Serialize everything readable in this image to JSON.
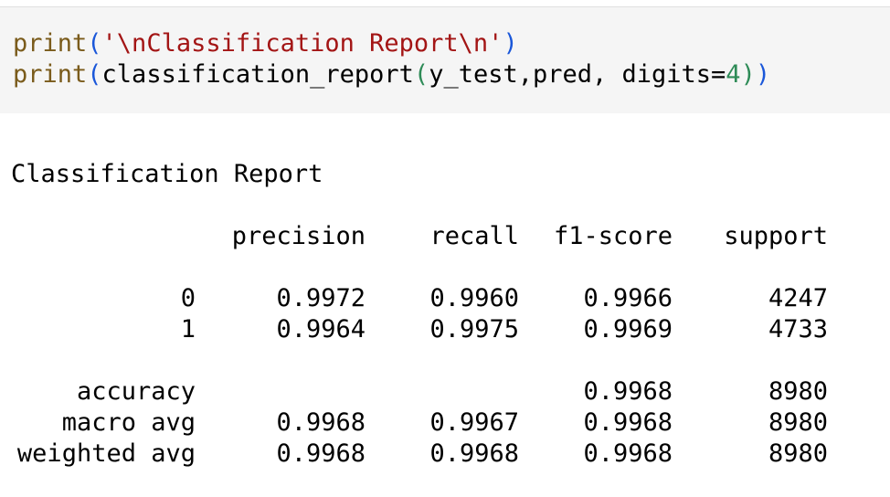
{
  "code": {
    "line1": {
      "func": "print",
      "open": "(",
      "string": "'\\nClassification Report\\n'",
      "close": ")"
    },
    "line2": {
      "func": "print",
      "open": "(",
      "call": "classification_report",
      "open2": "(",
      "args": "y_test,pred, digits=",
      "digits": "4",
      "close2": ")",
      "close": ")"
    }
  },
  "output": {
    "title": "Classification Report",
    "headers": {
      "precision": "precision",
      "recall": "recall",
      "f1": "f1-score",
      "support": "support"
    },
    "rows": [
      {
        "label": "0",
        "precision": "0.9972",
        "recall": "0.9960",
        "f1": "0.9966",
        "support": "4247"
      },
      {
        "label": "1",
        "precision": "0.9964",
        "recall": "0.9975",
        "f1": "0.9969",
        "support": "4733"
      },
      {
        "label": "accuracy",
        "precision": "",
        "recall": "",
        "f1": "0.9968",
        "support": "8980"
      },
      {
        "label": "macro avg",
        "precision": "0.9968",
        "recall": "0.9967",
        "f1": "0.9968",
        "support": "8980"
      },
      {
        "label": "weighted avg",
        "precision": "0.9968",
        "recall": "0.9968",
        "f1": "0.9968",
        "support": "8980"
      }
    ]
  }
}
